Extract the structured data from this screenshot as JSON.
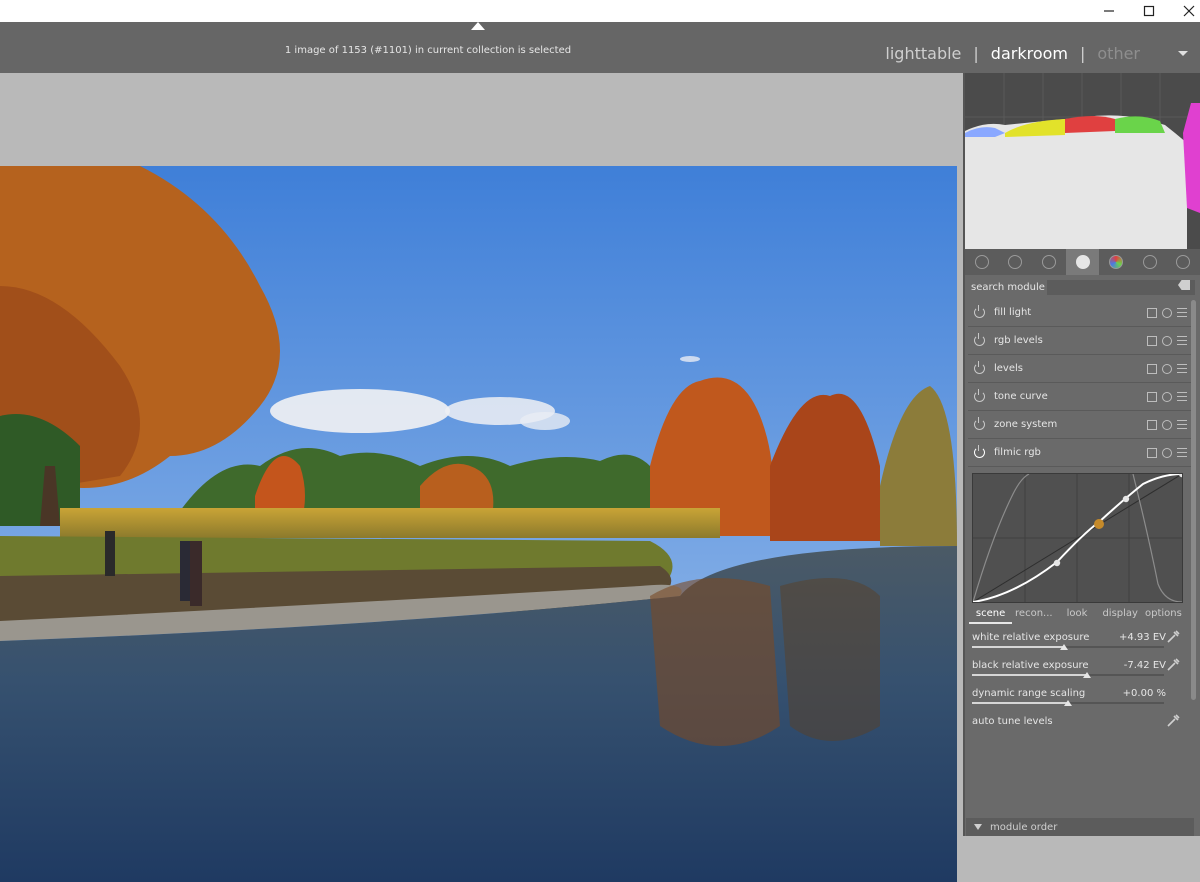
{
  "window": {
    "minimize_label": "✕",
    "maximize_label": "☐",
    "close_label": "✕"
  },
  "header": {
    "status": "1 image of 1153 (#1101) in current collection is selected",
    "views": [
      "lighttable",
      "darkroom",
      "other"
    ],
    "active_view": "darkroom",
    "separator": "|"
  },
  "search": {
    "label": "search module",
    "value": ""
  },
  "modules": [
    {
      "label": "fill light"
    },
    {
      "label": "rgb levels"
    },
    {
      "label": "levels"
    },
    {
      "label": "tone curve"
    },
    {
      "label": "zone system"
    },
    {
      "label": "filmic rgb"
    }
  ],
  "filmic": {
    "tabs": [
      "scene",
      "recon...",
      "look",
      "display",
      "options"
    ],
    "active_tab": "scene",
    "sliders": [
      {
        "label": "white relative exposure",
        "value": "+4.93 EV",
        "level": 0.48
      },
      {
        "label": "black relative exposure",
        "value": "-7.42 EV",
        "level": 0.6
      },
      {
        "label": "dynamic range scaling",
        "value": "+0.00 %",
        "level": 0.5
      }
    ],
    "auto_tune_label": "auto tune levels"
  },
  "footer": {
    "module_order_label": "module order"
  },
  "colors": {
    "header_bg": "#666666",
    "panel_bg": "#6a6a6a",
    "center_bg": "#b9b9b9",
    "accent_point": "#c58a2a"
  },
  "icons": [
    "minimize-icon",
    "maximize-icon",
    "close-icon",
    "dropdown-icon",
    "power-icon",
    "favorite-icon",
    "circle-icon",
    "tone-icon",
    "color-icon",
    "correct-icon",
    "effect-icon",
    "copy-icon",
    "reset-icon",
    "menu-icon",
    "picker-icon",
    "collapse-icon"
  ]
}
